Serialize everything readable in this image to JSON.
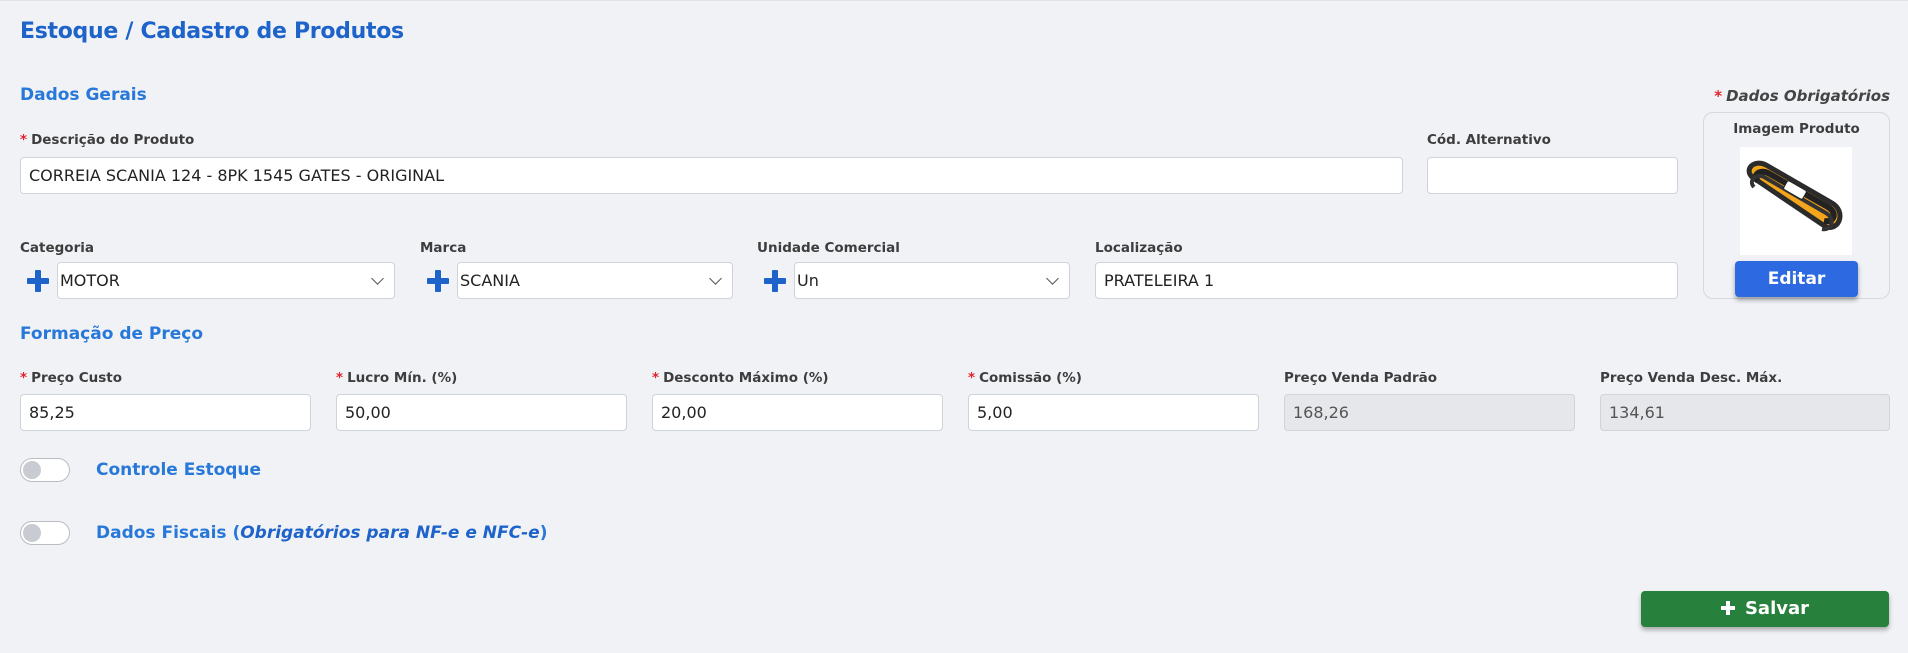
{
  "page_title": "Estoque / Cadastro de Produtos",
  "sections": {
    "general": "Dados Gerais",
    "pricing": "Formação de Preço"
  },
  "required_note": "Dados Obrigatórios",
  "fields": {
    "description": {
      "label": "Descrição do Produto",
      "value": "CORREIA SCANIA 124 - 8PK 1545 GATES - ORIGINAL"
    },
    "alt_code": {
      "label": "Cód. Alternativo",
      "value": ""
    },
    "category": {
      "label": "Categoria",
      "value": "MOTOR"
    },
    "brand": {
      "label": "Marca",
      "value": "SCANIA"
    },
    "unit": {
      "label": "Unidade Comercial",
      "value": "Un"
    },
    "location": {
      "label": "Localização",
      "value": "PRATELEIRA 1"
    },
    "cost_price": {
      "label": "Preço Custo",
      "value": "85,25"
    },
    "min_profit": {
      "label": "Lucro Mín. (%)",
      "value": "50,00"
    },
    "max_discount": {
      "label": "Desconto Máximo (%)",
      "value": "20,00"
    },
    "commission": {
      "label": "Comissão (%)",
      "value": "5,00"
    },
    "default_price": {
      "label": "Preço Venda Padrão",
      "value": "168,26"
    },
    "discount_price": {
      "label": "Preço Venda Desc. Máx.",
      "value": "134,61"
    }
  },
  "image": {
    "label": "Imagem Produto",
    "edit_label": "Editar"
  },
  "toggles": {
    "stock_control": {
      "label": "Controle Estoque",
      "on": false
    },
    "fiscal": {
      "label_main": "Dados Fiscais (",
      "label_italic": "Obrigatórios para NF-e e NFC-e",
      "label_end": ")",
      "on": false
    }
  },
  "save_label": "Salvar",
  "colors": {
    "accent": "#1d63c9",
    "required": "#e2232b",
    "save": "#27813d",
    "edit": "#2d69e0"
  }
}
